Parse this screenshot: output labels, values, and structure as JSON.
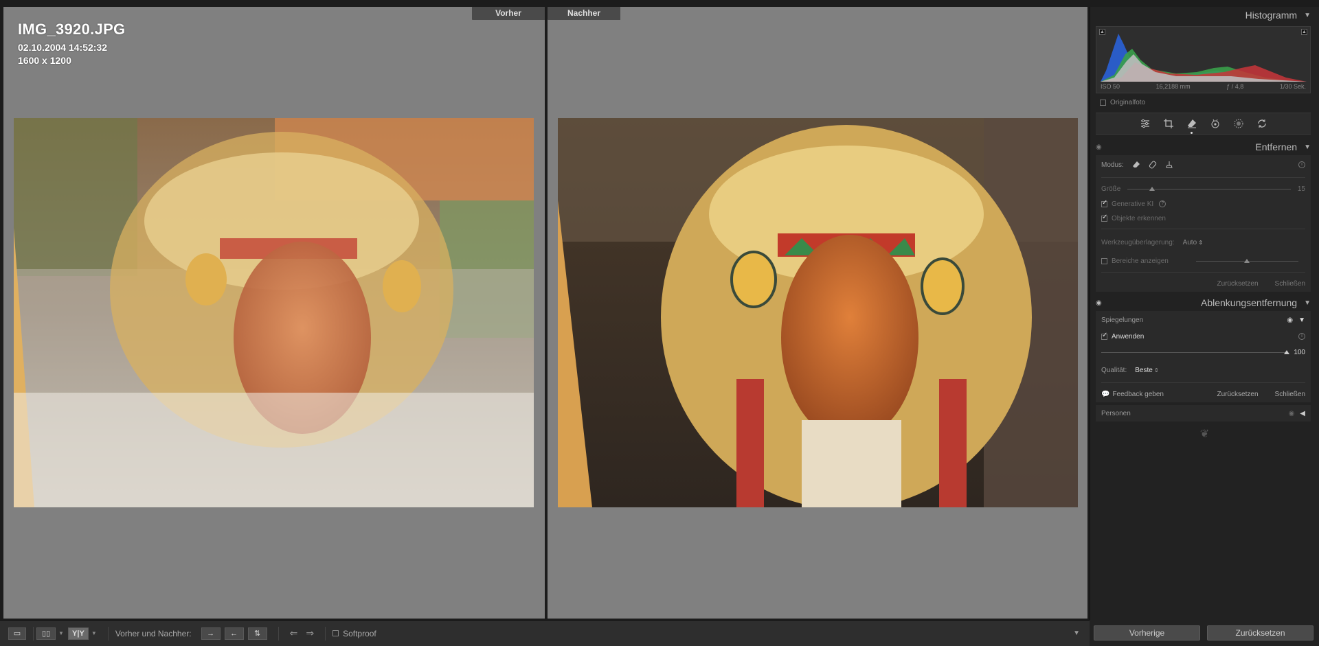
{
  "viewer": {
    "before_label": "Vorher",
    "after_label": "Nachher",
    "filename": "IMG_3920.JPG",
    "datetime": "02.10.2004 14:52:32",
    "dimensions": "1600 x 1200"
  },
  "histogram": {
    "title": "Histogramm",
    "iso": "ISO 50",
    "focal": "16,2188 mm",
    "aperture": "ƒ / 4,8",
    "shutter": "1/30 Sek.",
    "original_photo": "Originalfoto",
    "clip_warning_glyph": "▲"
  },
  "tools": {
    "items": [
      "sliders-icon",
      "crop-icon",
      "eraser-icon",
      "redeye-icon",
      "mask-icon",
      "presets-icon"
    ],
    "active": "eraser-icon"
  },
  "remove": {
    "title": "Entfernen",
    "mode_label": "Modus:",
    "size_label": "Größe",
    "size_value": "15",
    "size_fraction": 0.15,
    "generative_ai": "Generative KI",
    "detect_objects": "Objekte erkennen",
    "overlay_label": "Werkzeugüberlagerung:",
    "overlay_value": "Auto",
    "show_areas": "Bereiche anzeigen",
    "show_areas_fraction": 0.5,
    "reset": "Zurücksetzen",
    "close": "Schließen"
  },
  "distraction": {
    "title": "Ablenkungsentfernung",
    "reflections": "Spiegelungen",
    "apply": "Anwenden",
    "amount_value": "100",
    "amount_fraction": 1.0,
    "quality_label": "Qualität:",
    "quality_value": "Beste",
    "feedback": "Feedback geben",
    "reset": "Zurücksetzen",
    "close": "Schließen",
    "people": "Personen"
  },
  "toolbar": {
    "before_after_label": "Vorher und Nachher:",
    "softproof": "Softproof",
    "view_yy": "Y|Y"
  },
  "bottom_buttons": {
    "previous": "Vorherige",
    "reset": "Zurücksetzen"
  },
  "colors": {
    "panel_bg": "#222222",
    "viewer_bg": "#808080",
    "histo_blue": "#2a5fd0",
    "histo_green": "#3aa04a",
    "histo_red": "#c8353a"
  }
}
